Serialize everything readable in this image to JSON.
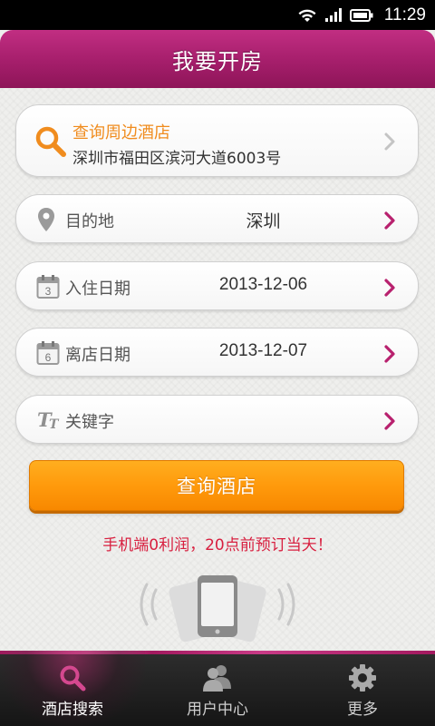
{
  "status_bar": {
    "time": "11:29"
  },
  "header": {
    "title": "我要开房"
  },
  "nearby": {
    "title": "查询周边酒店",
    "address": "深圳市福田区滨河大道6003号"
  },
  "rows": {
    "destination": {
      "label": "目的地",
      "value": "深圳"
    },
    "checkin": {
      "label": "入住日期",
      "value": "2013-12-06",
      "icon_day": "3"
    },
    "checkout": {
      "label": "离店日期",
      "value": "2013-12-07",
      "icon_day": "6"
    },
    "keyword": {
      "label": "关键字",
      "value": ""
    }
  },
  "search_button": {
    "label": "查询酒店"
  },
  "promo": {
    "text": "手机端0利润，20点前预订当天！"
  },
  "tabs": [
    {
      "label": "酒店搜索",
      "icon": "search-icon",
      "active": true
    },
    {
      "label": "用户中心",
      "icon": "users-icon",
      "active": false
    },
    {
      "label": "更多",
      "icon": "gear-icon",
      "active": false
    }
  ],
  "colors": {
    "brand": "#a51e6b",
    "accent_orange": "#ff9a0c",
    "promo_red": "#d81f3f",
    "nearby_orange": "#f08c1e"
  }
}
